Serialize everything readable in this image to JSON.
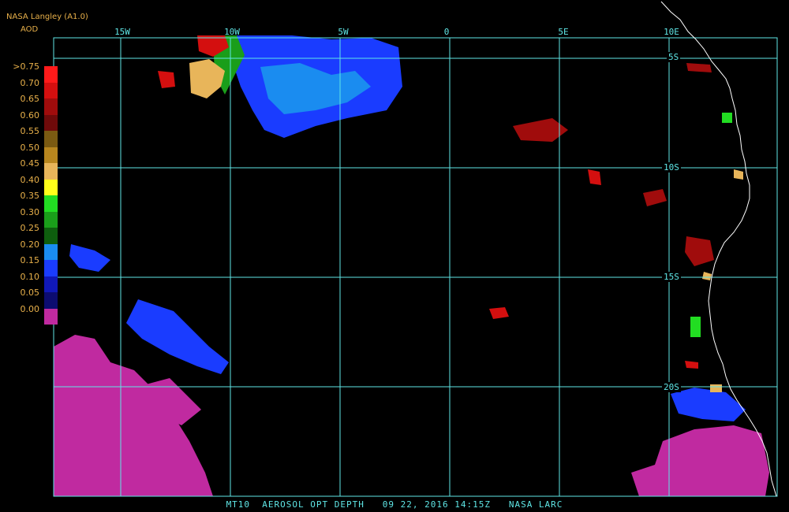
{
  "header": {
    "title": "NASA Langley (A1.0)",
    "unit": "AOD"
  },
  "footer": {
    "caption": "MT10  AEROSOL OPT DEPTH   09 22, 2016 14:15Z   NASA LARC"
  },
  "grid": {
    "lon_labels": [
      "15W",
      "10W",
      "5W",
      "0",
      "5E",
      "10E"
    ],
    "lat_labels": [
      "5S",
      "10S",
      "15S",
      "20S"
    ]
  },
  "legend": {
    "ticks": [
      ">0.75",
      "0.70",
      "0.65",
      "0.60",
      "0.55",
      "0.50",
      "0.45",
      "0.40",
      "0.35",
      "0.30",
      "0.25",
      "0.20",
      "0.15",
      "0.10",
      "0.05",
      "0.00"
    ],
    "colors": [
      "#ff1a1a",
      "#d40f0f",
      "#a00c0c",
      "#6e0a0a",
      "#7a5a12",
      "#b8861e",
      "#e8b55a",
      "#ffff1a",
      "#22dd22",
      "#1a9e1a",
      "#0e5e0e",
      "#1a8cf0",
      "#1a3cff",
      "#1018b8",
      "#0c0c70",
      "#c02aa0"
    ]
  },
  "colors": {
    "grid": "#5fe6e6",
    "coast": "#ffffff",
    "label": "#e8b04a"
  }
}
